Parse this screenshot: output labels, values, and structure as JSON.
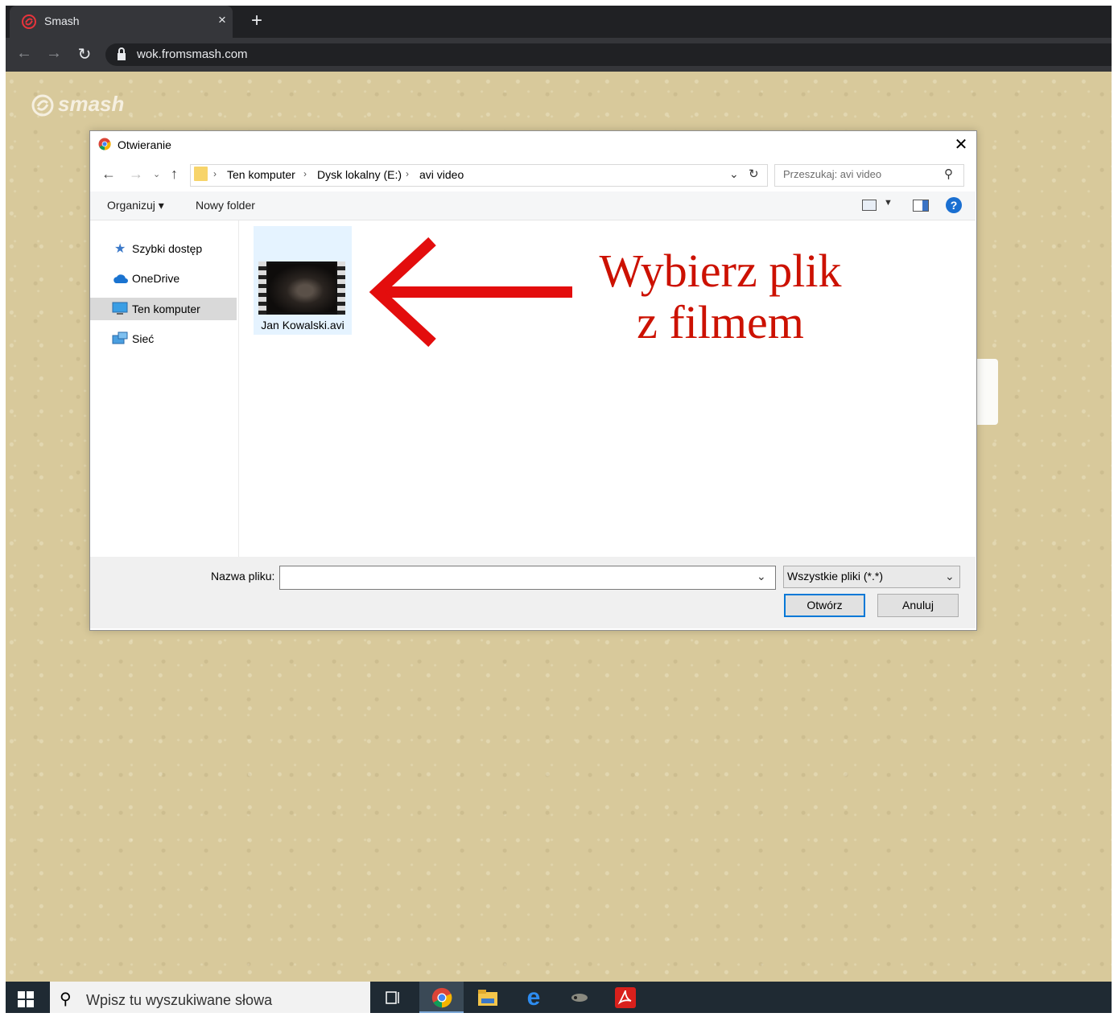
{
  "browser": {
    "tab_title": "Smash",
    "close_tab": "×",
    "new_tab": "+",
    "url": "wok.fromsmash.com"
  },
  "page": {
    "logo_text": "smash"
  },
  "dialog": {
    "title": "Otwieranie",
    "close": "✕",
    "breadcrumb": [
      "Ten komputer",
      "Dysk lokalny (E:)",
      "avi video"
    ],
    "search_placeholder": "Przeszukaj: avi video",
    "toolbar": {
      "organize": "Organizuj ▾",
      "new_folder": "Nowy folder",
      "help": "?"
    },
    "nav_items": [
      {
        "label": "Szybki dostęp",
        "icon": "star-icon"
      },
      {
        "label": "OneDrive",
        "icon": "cloud-icon"
      },
      {
        "label": "Ten komputer",
        "icon": "computer-icon",
        "selected": true
      },
      {
        "label": "Sieć",
        "icon": "network-icon"
      }
    ],
    "files": [
      {
        "name": "Jan Kowalski.avi",
        "icon": "video-file-icon"
      }
    ],
    "annotation": [
      "Wybierz plik",
      "z filmem"
    ],
    "filename_label": "Nazwa pliku:",
    "filename_value": "",
    "file_type": "Wszystkie pliki (*.*)",
    "open_button": "Otwórz",
    "cancel_button": "Anuluj"
  },
  "taskbar": {
    "search_placeholder": "Wpisz tu wyszukiwane słowa",
    "apps": [
      "task-view-icon",
      "chrome-icon",
      "file-explorer-icon",
      "edge-icon",
      "video-app-icon",
      "acrobat-icon"
    ]
  },
  "colors": {
    "annotation_red": "#cc1100",
    "accent_blue": "#0078d7",
    "page_bg": "#d8c99b"
  }
}
